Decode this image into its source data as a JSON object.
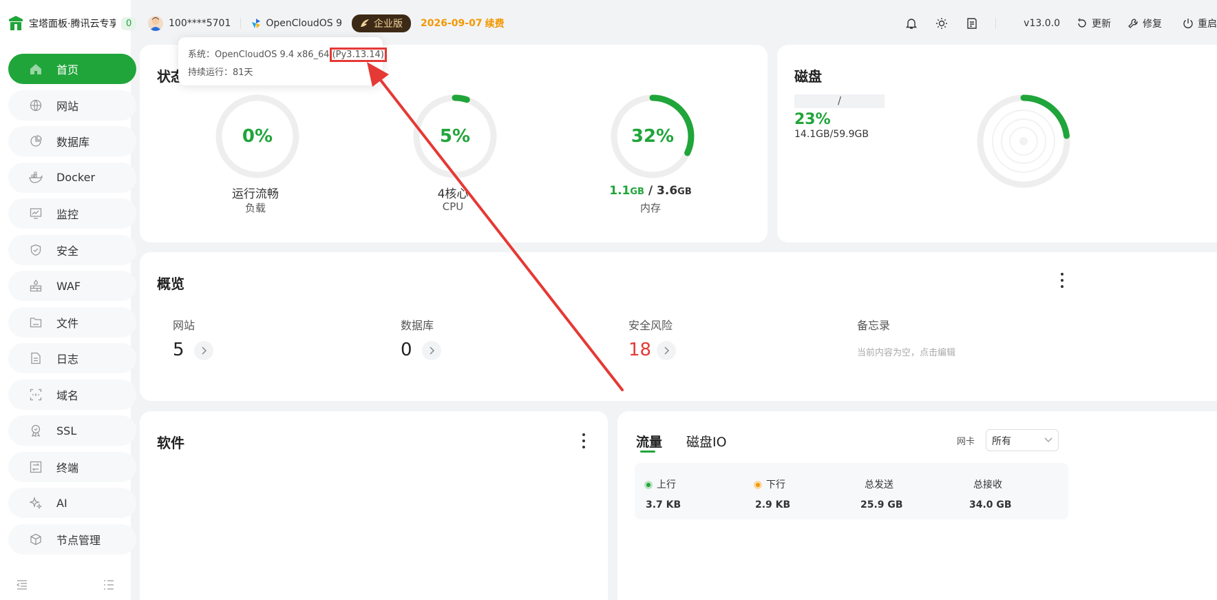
{
  "brand": {
    "name": "宝塔面板·腾讯云专享版",
    "badge": "0"
  },
  "nav": [
    {
      "label": "首页",
      "icon": "home-icon",
      "active": true
    },
    {
      "label": "网站",
      "icon": "globe-icon"
    },
    {
      "label": "数据库",
      "icon": "database-icon"
    },
    {
      "label": "Docker",
      "icon": "docker-icon"
    },
    {
      "label": "监控",
      "icon": "monitor-icon"
    },
    {
      "label": "安全",
      "icon": "shield-icon"
    },
    {
      "label": "WAF",
      "icon": "firewall-icon"
    },
    {
      "label": "文件",
      "icon": "folder-icon"
    },
    {
      "label": "日志",
      "icon": "log-icon"
    },
    {
      "label": "域名",
      "icon": "domain-icon"
    },
    {
      "label": "SSL",
      "icon": "ssl-icon"
    },
    {
      "label": "终端",
      "icon": "terminal-icon"
    },
    {
      "label": "AI",
      "icon": "ai-icon"
    },
    {
      "label": "节点管理",
      "icon": "node-icon"
    }
  ],
  "topbar": {
    "user": "100****5701",
    "os": "OpenCloudOS 9",
    "edition": "企业版",
    "expire": "2026-09-07",
    "renew": "续费",
    "version": "v13.0.0",
    "update": "更新",
    "repair": "修复",
    "restart": "重启"
  },
  "tooltip": {
    "system_prefix": "系统：OpenCloudOS 9.4 x86_64",
    "python": "(Py3.13.14)",
    "uptime": "持续运行：81天"
  },
  "status": {
    "title": "状态",
    "load": {
      "value": "0%",
      "percent": 0,
      "label": "运行流畅",
      "sub": "负载"
    },
    "cpu": {
      "value": "5%",
      "percent": 5,
      "label": "4核心",
      "sub": "CPU"
    },
    "mem": {
      "value": "32%",
      "percent": 32,
      "used": "1.1",
      "used_unit": "GB",
      "sep": "/",
      "total": "3.6",
      "total_unit": "GB",
      "sub": "内存"
    }
  },
  "disk": {
    "title": "磁盘",
    "path": "/",
    "value": "23%",
    "percent": 23,
    "usage": "14.1GB/59.9GB"
  },
  "overview": {
    "title": "概览",
    "items": [
      {
        "label": "网站",
        "value": "5"
      },
      {
        "label": "数据库",
        "value": "0"
      },
      {
        "label": "安全风险",
        "value": "18"
      }
    ],
    "memo_label": "备忘录",
    "memo_text": "当前内容为空，点击编辑"
  },
  "software": {
    "title": "软件"
  },
  "traffic": {
    "tabs": [
      "流量",
      "磁盘IO"
    ],
    "nic_label": "网卡",
    "nic_value": "所有",
    "up_label": "上行",
    "up_value": "3.7 KB",
    "down_label": "下行",
    "down_value": "2.9 KB",
    "sent_label": "总发送",
    "sent_value": "25.9 GB",
    "recv_label": "总接收",
    "recv_value": "34.0 GB"
  },
  "colors": {
    "accent": "#20a53a",
    "danger": "#e53935",
    "warning": "#f39800"
  }
}
